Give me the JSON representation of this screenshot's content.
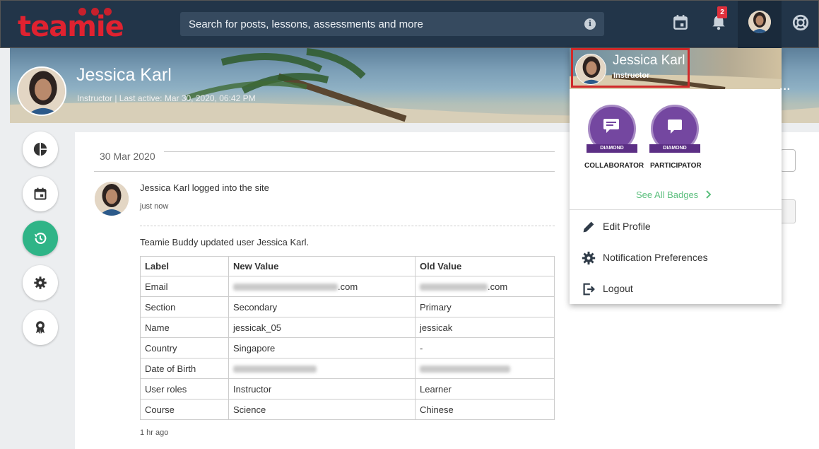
{
  "brand": {
    "logo_text": "teamie",
    "accent": "#e02230",
    "active_green": "#2fb487"
  },
  "search": {
    "placeholder": "Search for posts, lessons, assessments and more"
  },
  "header": {
    "notification_count": "2"
  },
  "profile": {
    "name": "Jessica Karl",
    "subtitle": "Instructor | Last active: Mar 30, 2020, 06:42 PM"
  },
  "sidebar": {
    "items": [
      {
        "icon": "pie-chart-icon"
      },
      {
        "icon": "calendar-icon"
      },
      {
        "icon": "history-icon",
        "active": true
      },
      {
        "icon": "gear-icon"
      },
      {
        "icon": "award-icon"
      }
    ]
  },
  "activity": {
    "date": "30 Mar 2020",
    "entries": [
      {
        "text": "Jessica Karl logged into the site",
        "time": "just now"
      },
      {
        "text": "Teamie Buddy updated user Jessica Karl.",
        "time": "1 hr ago"
      }
    ],
    "table": {
      "headers": [
        "Label",
        "New Value",
        "Old Value"
      ],
      "rows": [
        [
          "Email",
          ".com",
          ".com"
        ],
        [
          "Section",
          "Secondary",
          "Primary"
        ],
        [
          "Name",
          "jessicak_05",
          "jessicak"
        ],
        [
          "Country",
          "Singapore",
          "-"
        ],
        [
          "Date of Birth",
          "",
          ""
        ],
        [
          "User roles",
          "Instructor",
          "Learner"
        ],
        [
          "Course",
          "Science",
          "Chinese"
        ]
      ]
    }
  },
  "dropdown": {
    "name": "Jessica Karl",
    "role": "Instructor",
    "badges": [
      {
        "level": "DIAMOND",
        "label": "COLLABORATOR"
      },
      {
        "level": "DIAMOND",
        "label": "PARTICIPATOR"
      }
    ],
    "see_all": "See All Badges",
    "menu": [
      {
        "label": "Edit Profile",
        "icon": "pencil-icon"
      },
      {
        "label": "Notification Preferences",
        "icon": "gear-icon"
      },
      {
        "label": "Logout",
        "icon": "logout-icon"
      }
    ]
  }
}
